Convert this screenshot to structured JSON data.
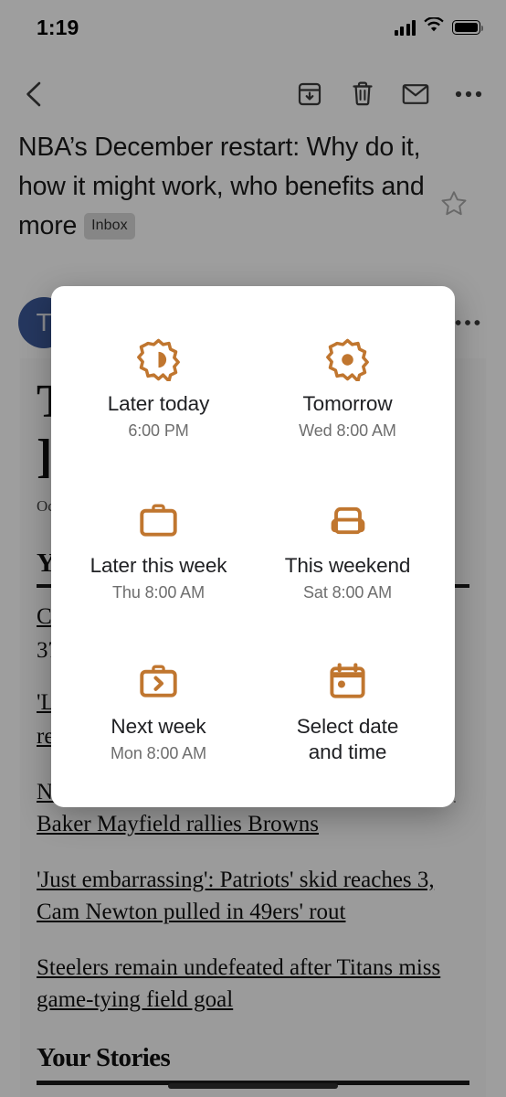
{
  "status_bar": {
    "time": "1:19",
    "icons": [
      "signal-bars",
      "wifi",
      "battery"
    ]
  },
  "toolbar": {
    "back_label": "‹",
    "buttons": [
      {
        "name": "archive",
        "label": "Archive"
      },
      {
        "name": "delete",
        "label": "Delete"
      },
      {
        "name": "mark-unread",
        "label": "Mark unread"
      },
      {
        "name": "more-options",
        "label": "More options"
      }
    ]
  },
  "email": {
    "subject": "NBA’s December restart: Why do it, how it might work, who benefits and more",
    "label_chip": "Inbox",
    "star": "☆",
    "avatar_letter": "T",
    "more_glyph": "•••"
  },
  "newsletter": {
    "title_line1": "T",
    "title_line2": "]",
    "date": "Oc",
    "section_1": "Y",
    "partial_links": [
      "Ca",
      "37",
      "'L",
      "re"
    ],
    "links": [
      "NFL roundup: Tom Brady, Bucs rout Raiders; Baker Mayfield rallies Browns",
      "'Just embarrassing': Patriots' skid reaches 3, Cam Newton pulled in 49ers' rout",
      "Steelers remain undefeated after Titans miss game-tying field goal"
    ],
    "section_2": "Your Stories"
  },
  "snooze_dialog": {
    "accent_color": "#C0762F",
    "options": [
      {
        "id": "later-today",
        "icon": "sun-half-icon",
        "label": "Later today",
        "sub": "6:00 PM"
      },
      {
        "id": "tomorrow",
        "icon": "sun-icon",
        "label": "Tomorrow",
        "sub": "Wed 8:00 AM"
      },
      {
        "id": "later-this-week",
        "icon": "briefcase-icon",
        "label": "Later this week",
        "sub": "Thu 8:00 AM"
      },
      {
        "id": "this-weekend",
        "icon": "sofa-icon",
        "label": "This weekend",
        "sub": "Sat 8:00 AM"
      },
      {
        "id": "next-week",
        "icon": "briefcase-arrow-icon",
        "label": "Next week",
        "sub": "Mon 8:00 AM"
      },
      {
        "id": "select-date-and-time",
        "icon": "calendar-icon",
        "label": "Select date and time",
        "sub": ""
      }
    ]
  }
}
